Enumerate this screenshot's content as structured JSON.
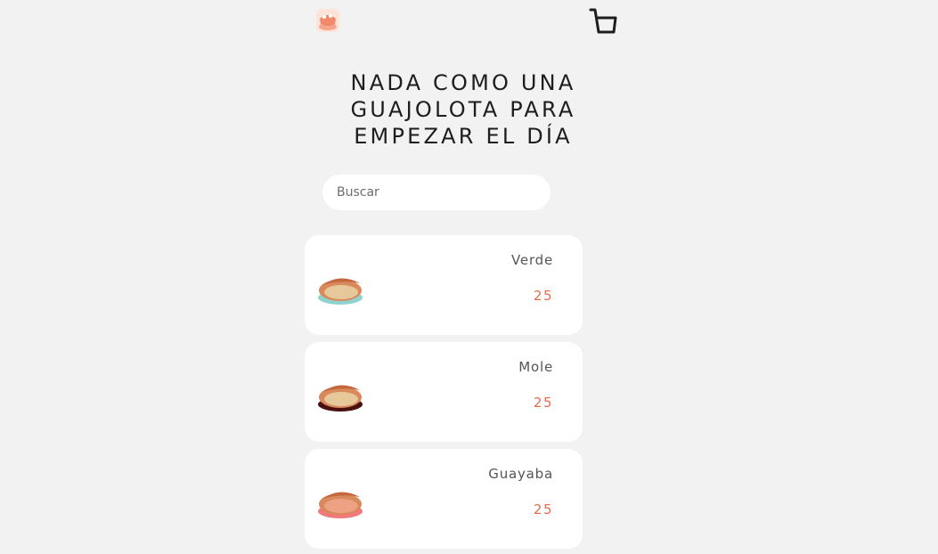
{
  "header": {
    "logo_icon": "guajolota-logo-icon",
    "cart_icon": "shopping-cart-icon"
  },
  "headline": {
    "line1": "NADA COMO UNA",
    "line2": "GUAJOLOTA PARA",
    "line3": "EMPEZAR EL DÍA"
  },
  "search": {
    "placeholder": "Buscar"
  },
  "products": [
    {
      "name": "Verde",
      "price": "25",
      "icon": "guajolota-verde-icon",
      "plate_color": "#8fd3cf"
    },
    {
      "name": "Mole",
      "price": "25",
      "icon": "guajolota-mole-icon",
      "plate_color": "#4a1010"
    },
    {
      "name": "Guayaba",
      "price": "25",
      "icon": "guajolota-guayaba-icon",
      "plate_color": "#f07a7a"
    }
  ],
  "colors": {
    "background": "#f2f2f2",
    "card": "#ffffff",
    "price": "#e86a4e",
    "headline": "#1e1e1e",
    "logo_accent": "#f08a6a"
  }
}
